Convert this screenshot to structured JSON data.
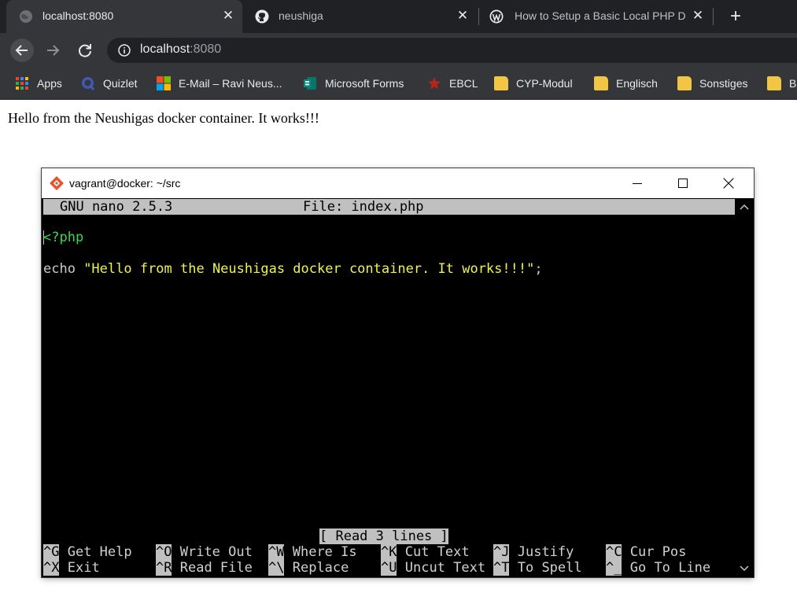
{
  "browser": {
    "tabs": [
      {
        "title": "localhost:8080",
        "active": true,
        "icon": "globe-icon"
      },
      {
        "title": "neushiga",
        "active": false,
        "icon": "github-icon"
      },
      {
        "title": "How to Setup a Basic Local PHP D",
        "active": false,
        "icon": "wordpress-icon"
      }
    ],
    "close_glyph": "✕",
    "new_tab_glyph": "+",
    "address": {
      "host": "localhost",
      "port": ":8080"
    },
    "bookmarks": [
      {
        "label": "Apps",
        "icon": "apps-grid-icon"
      },
      {
        "label": "Quizlet",
        "icon": "quizlet-icon"
      },
      {
        "label": "E-Mail – Ravi Neus...",
        "icon": "microsoft-icon"
      },
      {
        "label": "Microsoft Forms",
        "icon": "forms-icon"
      },
      {
        "label": "EBCL",
        "icon": "star-icon"
      },
      {
        "label": "CYP-Modul",
        "icon": "folder-icon"
      },
      {
        "label": "Englisch",
        "icon": "folder-icon"
      },
      {
        "label": "Sonstiges",
        "icon": "folder-icon"
      },
      {
        "label": "BM",
        "icon": "folder-icon"
      }
    ]
  },
  "page": {
    "text": "Hello from the Neushigas docker container. It works!!!"
  },
  "terminal": {
    "title": "vagrant@docker: ~/src",
    "nano": {
      "version": "GNU nano 2.5.3",
      "file": "File: index.php",
      "line1": "<?php",
      "line2_prefix": "echo ",
      "line2_string": "\"Hello from the Neushigas docker container. It works!!!\"",
      "line2_suffix": ";",
      "status": "[ Read 3 lines ]",
      "shortcuts_row1": [
        {
          "key": "^G",
          "label": "Get Help"
        },
        {
          "key": "^O",
          "label": "Write Out"
        },
        {
          "key": "^W",
          "label": "Where Is"
        },
        {
          "key": "^K",
          "label": "Cut Text"
        },
        {
          "key": "^J",
          "label": "Justify"
        },
        {
          "key": "^C",
          "label": "Cur Pos"
        }
      ],
      "shortcuts_row2": [
        {
          "key": "^X",
          "label": "Exit"
        },
        {
          "key": "^R",
          "label": "Read File"
        },
        {
          "key": "^\\",
          "label": "Replace"
        },
        {
          "key": "^U",
          "label": "Uncut Text"
        },
        {
          "key": "^T",
          "label": "To Spell"
        },
        {
          "key": "^_",
          "label": "Go To Line"
        }
      ]
    }
  },
  "colors": {
    "chrome_dark": "#202124",
    "chrome_toolbar": "#35363a",
    "nano_bar": "#c0c0c0",
    "php_tag": "#3bd74a",
    "php_string": "#f2f24a"
  }
}
